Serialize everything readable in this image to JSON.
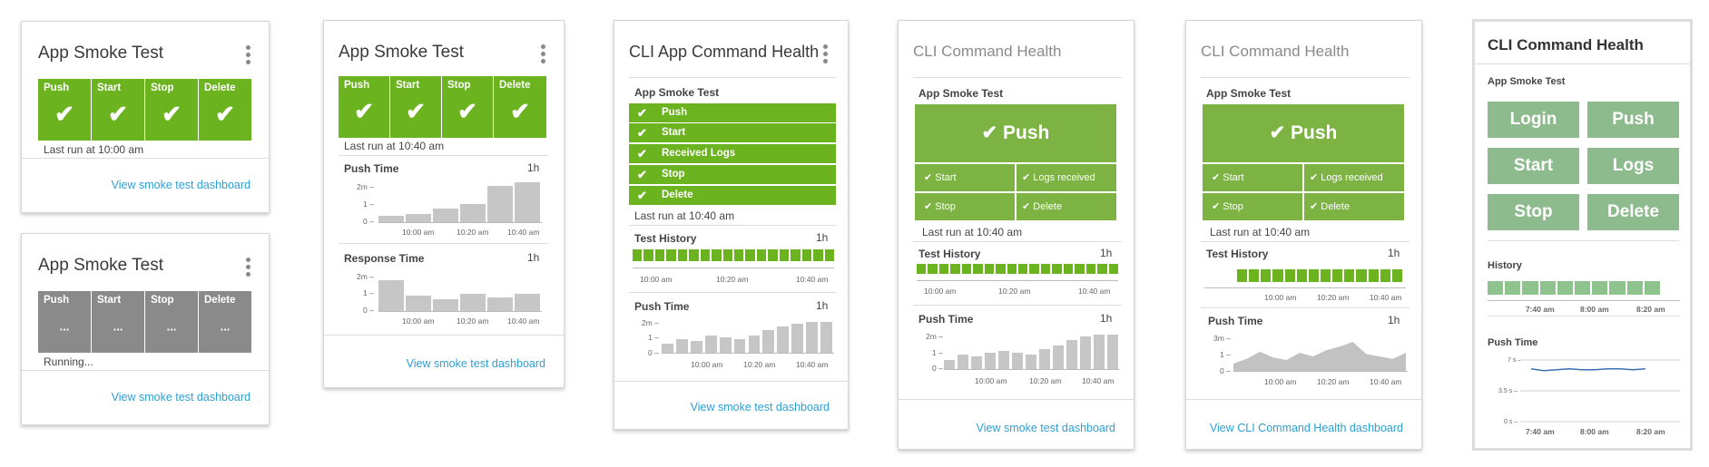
{
  "card1": {
    "title": "App Smoke Test",
    "tiles": [
      {
        "label": "Push"
      },
      {
        "label": "Start"
      },
      {
        "label": "Stop"
      },
      {
        "label": "Delete"
      }
    ],
    "check": "✔",
    "last_run": "Last run at 10:00 am",
    "link": "View smoke test dashboard"
  },
  "card2": {
    "title": "App Smoke Test",
    "tiles": [
      {
        "label": "Push"
      },
      {
        "label": "Start"
      },
      {
        "label": "Stop"
      },
      {
        "label": "Delete"
      }
    ],
    "dots": "...",
    "status": "Running...",
    "link": "View smoke test dashboard"
  },
  "card3": {
    "title": "App Smoke Test",
    "tiles": [
      {
        "label": "Push"
      },
      {
        "label": "Start"
      },
      {
        "label": "Stop"
      },
      {
        "label": "Delete"
      }
    ],
    "check": "✔",
    "last_run": "Last run at 10:40 am",
    "push_time": {
      "label": "Push Time",
      "range": "1h",
      "yticks": [
        "2m –",
        "1 –",
        "0 –"
      ],
      "xticks": [
        "10:00 am",
        "10:20 am",
        "10:40 am"
      ]
    },
    "response_time": {
      "label": "Response Time",
      "range": "1h",
      "yticks": [
        "2m –",
        "1 –",
        "0 –"
      ],
      "xticks": [
        "10:00 am",
        "10:20 am",
        "10:40 am"
      ]
    },
    "link": "View smoke test dashboard"
  },
  "card4": {
    "title": "CLI App Command  Health",
    "section": "App Smoke Test",
    "rows": [
      "Push",
      "Start",
      "Received Logs",
      "Stop",
      "Delete"
    ],
    "check": "✔",
    "last_run": "Last run at 10:40 am",
    "history": {
      "label": "Test History",
      "range": "1h",
      "xticks": [
        "10:00 am",
        "10:20 am",
        "10:40 am"
      ]
    },
    "push_time": {
      "label": "Push Time",
      "range": "1h",
      "yticks": [
        "2m –",
        "1 –",
        "0 –"
      ],
      "xticks": [
        "10:00 am",
        "10:20 am",
        "10:40 am"
      ]
    },
    "link": "View smoke test dashboard"
  },
  "card5": {
    "title": "CLI Command Health",
    "section": "App Smoke Test",
    "main": "✔ Push",
    "cells": [
      "✔  Start",
      "✔  Logs received",
      "✔  Stop",
      "✔  Delete"
    ],
    "last_run": "Last run at 10:40 am",
    "history": {
      "label": "Test History",
      "range": "1h",
      "xticks": [
        "10:00 am",
        "10:20 am",
        "10:40 am"
      ]
    },
    "push_time": {
      "label": "Push Time",
      "range": "1h",
      "yticks": [
        "2m –",
        "1 –",
        "0 –"
      ],
      "xticks": [
        "10:00 am",
        "10:20 am",
        "10:40 am"
      ]
    },
    "link": "View smoke test dashboard"
  },
  "card6": {
    "title": "CLI Command Health",
    "section": "App Smoke Test",
    "main": "✔ Push",
    "cells": [
      "✔  Start",
      "✔  Logs received",
      "✔  Stop",
      "✔  Delete"
    ],
    "last_run": "Last run at 10:40 am",
    "history": {
      "label": "Test History",
      "range": "1h",
      "xticks": [
        "10:00 am",
        "10:20 am",
        "10:40 am"
      ]
    },
    "push_time": {
      "label": "Push Time",
      "range": "1h",
      "yticks": [
        "3m –",
        "1 –",
        "0 –"
      ],
      "xticks": [
        "10:00 am",
        "10:20 am",
        "10:40 am"
      ]
    },
    "link": "View CLI Command Health dashboard"
  },
  "card7": {
    "title": "CLI Command Health",
    "section": "App Smoke Test",
    "buttons": [
      "Login",
      "Push",
      "Start",
      "Logs",
      "Stop",
      "Delete"
    ],
    "history": {
      "label": "History",
      "xticks": [
        "7:40 am",
        "8:00 am",
        "8:20 am"
      ]
    },
    "push_time": {
      "label": "Push Time",
      "yticks": [
        "7 s –",
        "3.5 s –",
        "0 s –"
      ],
      "xticks": [
        "7:40 am",
        "8:00 am",
        "8:20 am"
      ]
    }
  },
  "chart_data": [
    {
      "type": "bar",
      "title": "Push Time",
      "ylabel": "",
      "xlabel": "",
      "ylim": [
        0,
        2
      ],
      "values": [
        0.3,
        0.4,
        0.7,
        0.9,
        1.8,
        2.0
      ]
    },
    {
      "type": "bar",
      "title": "Response Time",
      "ylabel": "",
      "xlabel": "",
      "ylim": [
        0,
        2
      ],
      "values": [
        1.6,
        0.8,
        0.6,
        0.9,
        0.7,
        0.9
      ]
    },
    {
      "type": "bar",
      "title": "Push Time",
      "ylabel": "",
      "xlabel": "",
      "ylim": [
        0,
        2
      ],
      "values": [
        0.5,
        0.8,
        0.7,
        1.0,
        0.9,
        0.8,
        1.0,
        1.3,
        1.5,
        1.7,
        1.8,
        1.8
      ]
    },
    {
      "type": "bar",
      "title": "Push Time",
      "ylabel": "",
      "xlabel": "",
      "ylim": [
        0,
        2
      ],
      "values": [
        0.5,
        0.8,
        0.7,
        0.9,
        1.0,
        0.9,
        0.8,
        1.1,
        1.3,
        1.6,
        1.8,
        1.9,
        1.9
      ]
    },
    {
      "type": "area",
      "title": "Push Time",
      "ylabel": "",
      "xlabel": "",
      "ylim": [
        0,
        3
      ],
      "values": [
        0.6,
        1.0,
        1.6,
        1.1,
        0.9,
        1.5,
        1.2,
        1.7,
        2.0,
        2.4,
        1.4,
        1.2,
        1.0,
        1.5
      ]
    },
    {
      "type": "line",
      "title": "Push Time",
      "ylabel": "",
      "xlabel": "",
      "ylim": [
        0,
        7
      ],
      "values": [
        6.0,
        5.8,
        5.9,
        6.0,
        5.9,
        5.9,
        6.0,
        6.0,
        5.9,
        6.0
      ]
    }
  ]
}
